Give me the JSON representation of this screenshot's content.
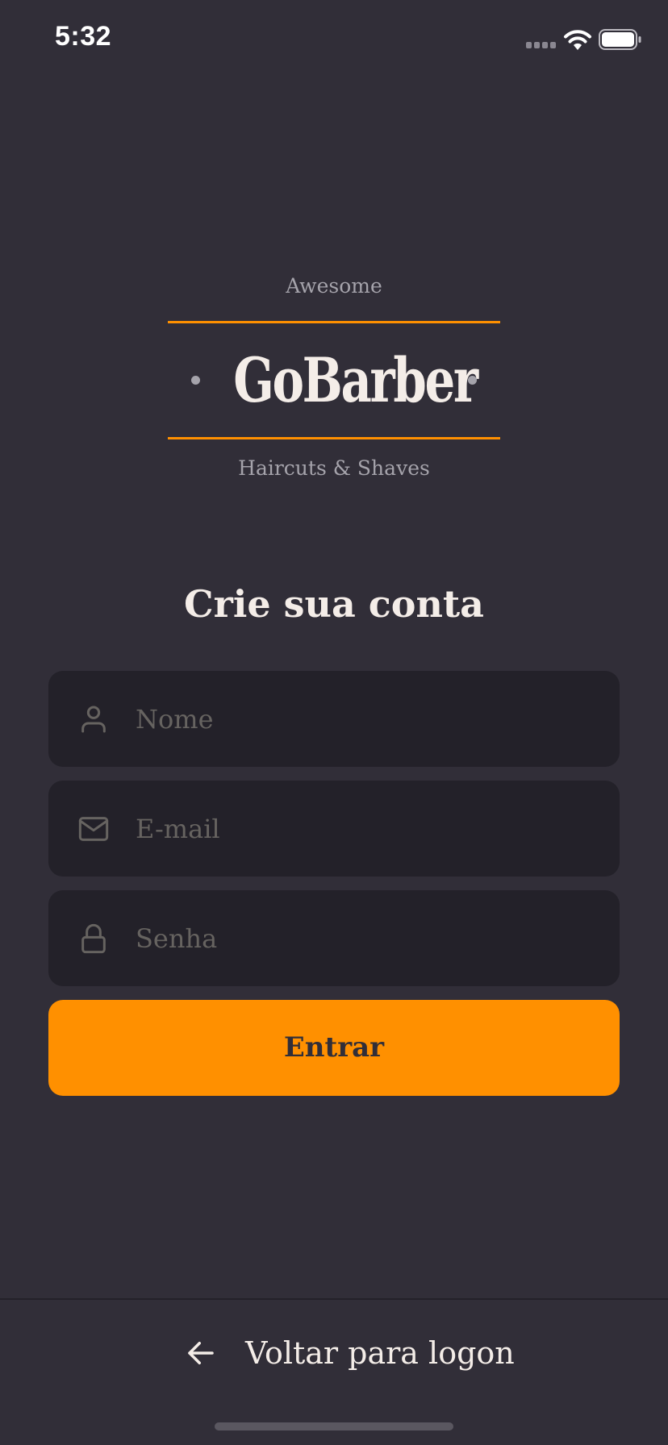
{
  "status_bar": {
    "time": "5:32",
    "icons": [
      "signal-icon",
      "wifi-icon",
      "battery-icon"
    ]
  },
  "logo": {
    "top_text": "Awesome",
    "word": "GoBarber",
    "bottom_text": "Haircuts & Shaves"
  },
  "form": {
    "title": "Crie sua conta",
    "fields": [
      {
        "icon": "user-icon",
        "placeholder": "Nome",
        "value": ""
      },
      {
        "icon": "mail-icon",
        "placeholder": "E-mail",
        "value": ""
      },
      {
        "icon": "lock-icon",
        "placeholder": "Senha",
        "value": ""
      }
    ],
    "submit_label": "Entrar"
  },
  "footer": {
    "back_icon": "arrow-left-icon",
    "back_label": "Voltar para logon"
  },
  "colors": {
    "background": "#312e38",
    "input_background": "#232129",
    "accent": "#ff9000",
    "text": "#f4ede8",
    "muted": "#a5a3ab",
    "placeholder": "#666360"
  }
}
